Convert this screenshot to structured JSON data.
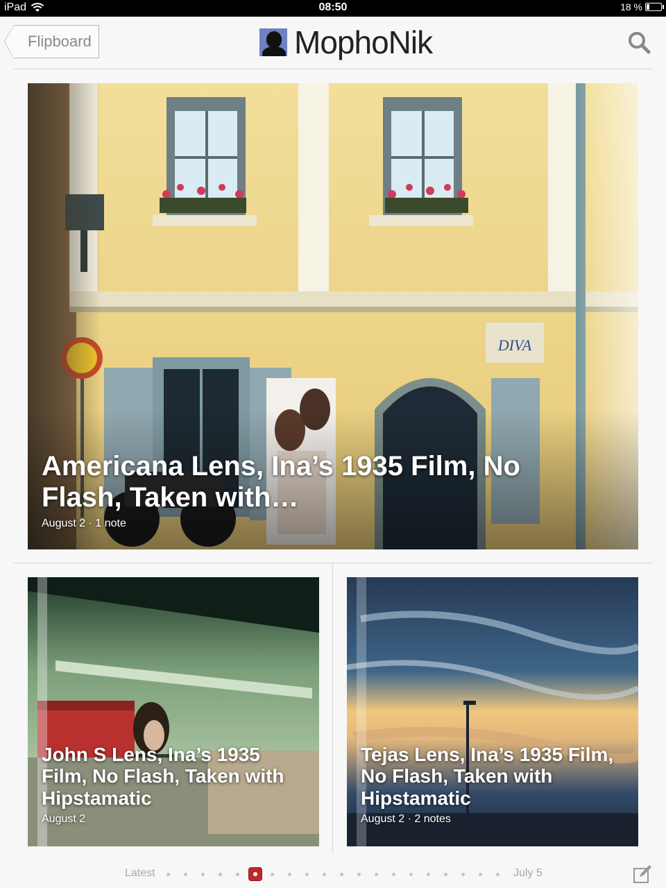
{
  "status_bar": {
    "device": "iPad",
    "time": "08:50",
    "battery": "18 %",
    "battery_level": 0.18
  },
  "header": {
    "back_label": "Flipboard",
    "title": "MophoNik",
    "icons": [
      "avatar",
      "search-icon"
    ]
  },
  "articles": [
    {
      "title": "Americana Lens, Ina’s 1935 Film, No Flash, Taken with…",
      "meta": "August 2 · 1 note"
    },
    {
      "title": "John S Lens, Ina’s 1935 Film, No Flash, Taken with Hipstamatic",
      "meta": "August 2"
    },
    {
      "title": "Tejas Lens, Ina’s 1935 Film, No Flash, Taken with Hipstamatic",
      "meta": "August 2 · 2 notes"
    }
  ],
  "pager": {
    "start_label": "Latest",
    "end_label": "July 5",
    "total_dots": 20,
    "active_index": 5
  },
  "colors": {
    "accent": "#c0262b",
    "background": "#f7f7f7"
  }
}
